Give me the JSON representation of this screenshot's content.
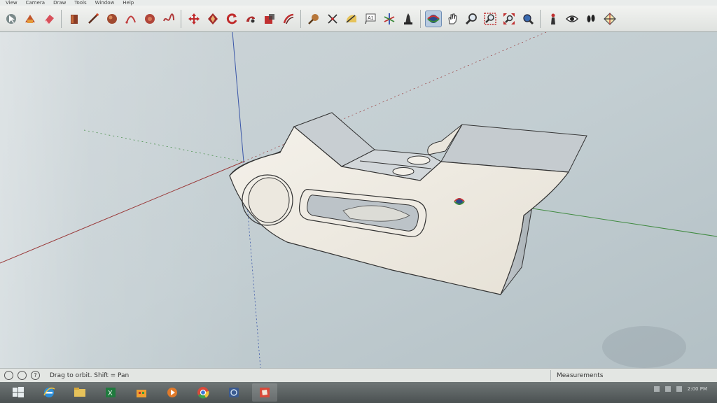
{
  "menu": {
    "items": [
      "View",
      "Camera",
      "Draw",
      "Tools",
      "Window",
      "Help"
    ]
  },
  "toolbar": {
    "tools": [
      {
        "name": "select-icon"
      },
      {
        "name": "make-component-icon"
      },
      {
        "name": "eraser-icon"
      },
      {
        "name": "paint-bucket-icon"
      },
      {
        "name": "line-icon"
      },
      {
        "name": "circle-icon"
      },
      {
        "name": "arc-icon"
      },
      {
        "name": "polygon-icon"
      },
      {
        "name": "freehand-icon"
      },
      {
        "name": "move-icon"
      },
      {
        "name": "push-pull-icon"
      },
      {
        "name": "rotate-icon"
      },
      {
        "name": "follow-me-icon"
      },
      {
        "name": "scale-icon"
      },
      {
        "name": "offset-icon"
      },
      {
        "name": "tape-measure-icon"
      },
      {
        "name": "dimension-icon"
      },
      {
        "name": "protractor-icon"
      },
      {
        "name": "text-icon"
      },
      {
        "name": "axes-icon"
      },
      {
        "name": "3d-text-icon"
      },
      {
        "name": "orbit-icon",
        "active": true
      },
      {
        "name": "pan-icon"
      },
      {
        "name": "zoom-icon"
      },
      {
        "name": "zoom-window-icon"
      },
      {
        "name": "zoom-extents-icon"
      },
      {
        "name": "previous-view-icon"
      },
      {
        "name": "position-camera-icon"
      },
      {
        "name": "look-around-icon"
      },
      {
        "name": "walk-icon"
      },
      {
        "name": "section-plane-icon"
      }
    ]
  },
  "status": {
    "hint": "Drag to orbit.  Shift = Pan",
    "measurements_label": "Measurements"
  },
  "taskbar": {
    "apps": [
      {
        "name": "start-icon"
      },
      {
        "name": "internet-explorer-icon"
      },
      {
        "name": "file-explorer-icon"
      },
      {
        "name": "excel-icon"
      },
      {
        "name": "store-icon"
      },
      {
        "name": "media-player-icon"
      },
      {
        "name": "chrome-icon"
      },
      {
        "name": "network-app-icon"
      },
      {
        "name": "sketchup-icon",
        "active": true
      }
    ],
    "clock": "2:00 PM"
  },
  "colors": {
    "model_face": "#efebe3",
    "model_shade": "#cdd2d6",
    "axis_blue": "#3a56a8",
    "axis_green": "#3f8a3f",
    "axis_red": "#9a3a3a",
    "active_tool": "#b8cbe0"
  }
}
